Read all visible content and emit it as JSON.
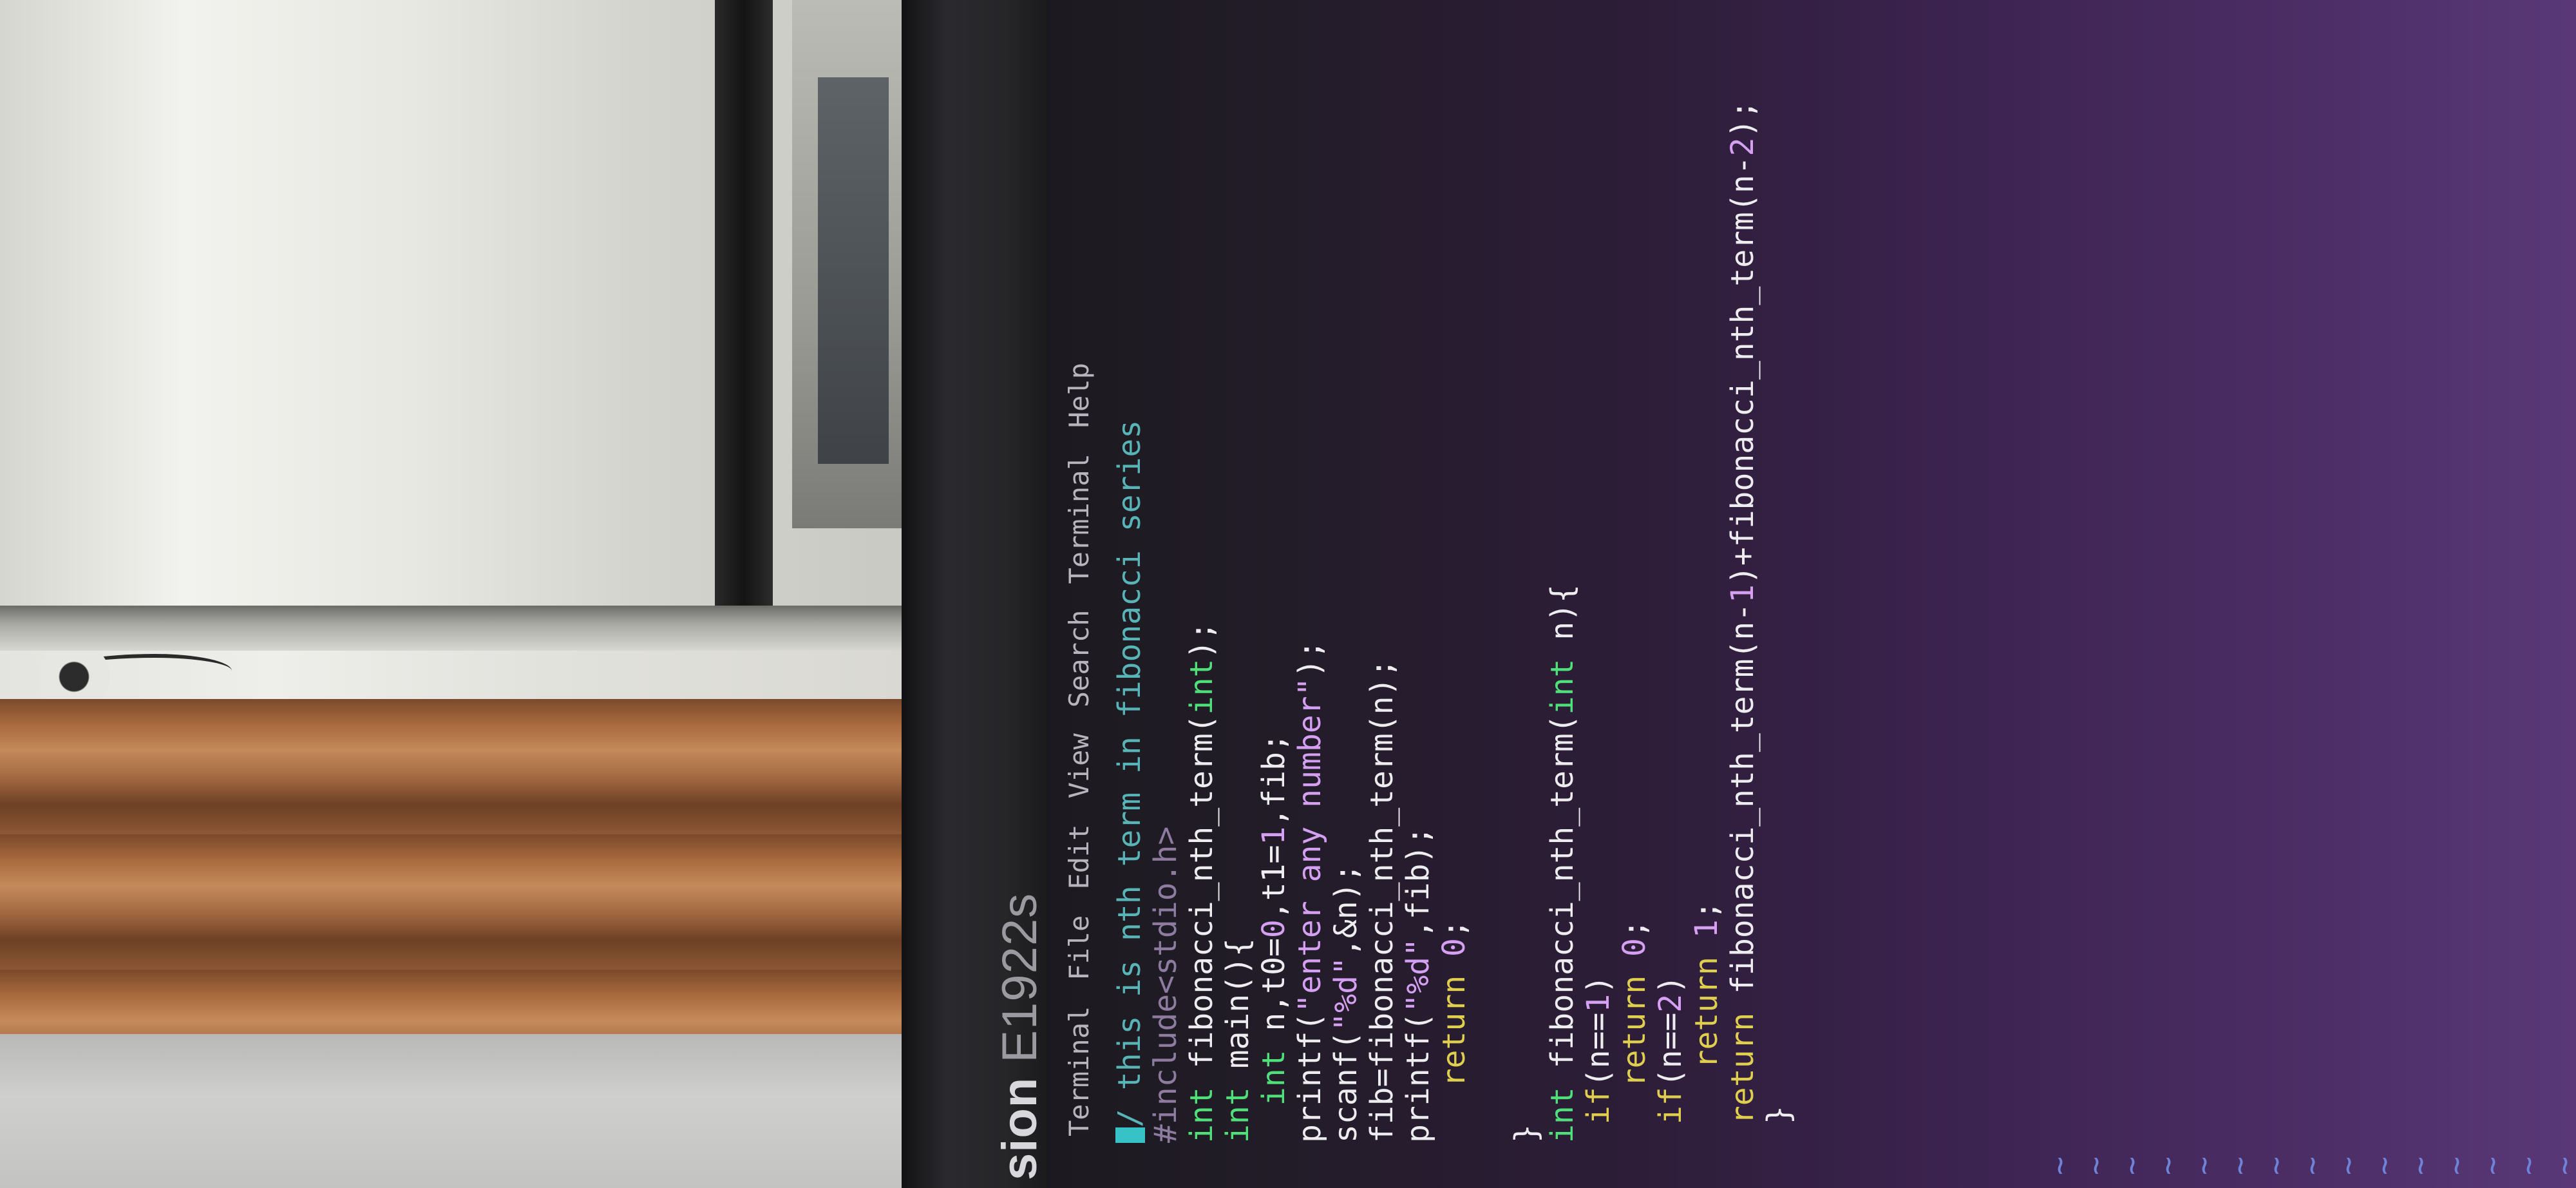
{
  "monitor": {
    "brand_partial": "sion",
    "model": "E1922s"
  },
  "terminal": {
    "menu": [
      "Terminal",
      "File",
      "Edit",
      "View",
      "Search",
      "Terminal",
      "Help"
    ],
    "code_lines": [
      [
        [
          "comment",
          "/ this is nth term in fibonacci series"
        ]
      ],
      [
        [
          "pre",
          "#include<stdio.h>"
        ]
      ],
      [
        [
          "type",
          "int"
        ],
        [
          "plain",
          " fibonacci_nth_term("
        ],
        [
          "type",
          "int"
        ],
        [
          "plain",
          ");"
        ]
      ],
      [
        [
          "type",
          "int"
        ],
        [
          "plain",
          " main(){"
        ]
      ],
      [
        [
          "plain",
          "  "
        ],
        [
          "type",
          "int"
        ],
        [
          "plain",
          " n,t0="
        ],
        [
          "num",
          "0"
        ],
        [
          "plain",
          ",t1="
        ],
        [
          "num",
          "1"
        ],
        [
          "plain",
          ",fib;"
        ]
      ],
      [
        [
          "plain",
          "printf("
        ],
        [
          "str",
          "\"enter any number\""
        ],
        [
          "plain",
          ");"
        ]
      ],
      [
        [
          "plain",
          "scanf("
        ],
        [
          "str",
          "\"%d\""
        ],
        [
          "plain",
          ",&n);"
        ]
      ],
      [
        [
          "plain",
          "fib=fibonacci_nth_term(n);"
        ]
      ],
      [
        [
          "plain",
          "printf("
        ],
        [
          "str",
          "\"%d\""
        ],
        [
          "plain",
          ",fib);"
        ]
      ],
      [
        [
          "plain",
          "   "
        ],
        [
          "kw",
          "return"
        ],
        [
          "plain",
          " "
        ],
        [
          "num",
          "0"
        ],
        [
          "plain",
          ";"
        ]
      ],
      [
        [
          "plain",
          ""
        ]
      ],
      [
        [
          "plain",
          "}"
        ]
      ],
      [
        [
          "type",
          "int"
        ],
        [
          "plain",
          " fibonacci_nth_term("
        ],
        [
          "type",
          "int"
        ],
        [
          "plain",
          " n){"
        ]
      ],
      [
        [
          "plain",
          " "
        ],
        [
          "kw",
          "if"
        ],
        [
          "plain",
          "(n=="
        ],
        [
          "num",
          "1"
        ],
        [
          "plain",
          ")"
        ]
      ],
      [
        [
          "plain",
          "   "
        ],
        [
          "kw",
          "return"
        ],
        [
          "plain",
          " "
        ],
        [
          "num",
          "0"
        ],
        [
          "plain",
          ";"
        ]
      ],
      [
        [
          "plain",
          " "
        ],
        [
          "kw",
          "if"
        ],
        [
          "plain",
          "(n=="
        ],
        [
          "num",
          "2"
        ],
        [
          "plain",
          ")"
        ]
      ],
      [
        [
          "plain",
          "    "
        ],
        [
          "kw",
          "return"
        ],
        [
          "plain",
          " "
        ],
        [
          "num",
          "1"
        ],
        [
          "plain",
          ";"
        ]
      ],
      [
        [
          "plain",
          " "
        ],
        [
          "kw",
          "return"
        ],
        [
          "plain",
          " fibonacci_nth_term(n-"
        ],
        [
          "num",
          "1"
        ],
        [
          "plain",
          ")+fibonacci_nth_term(n-"
        ],
        [
          "num",
          "2"
        ],
        [
          "plain",
          ");"
        ]
      ],
      [
        [
          "plain",
          " }"
        ]
      ]
    ],
    "empty_line_marker": "~",
    "empty_line_count": 15,
    "colors": {
      "comment": "#58b4b6",
      "preprocessor": "#8e7ca0",
      "type": "#4fe07a",
      "keyword": "#e0cf4f",
      "literal": "#d5a0f2",
      "cursor": "#36c2c6",
      "tilde": "#6d84d8"
    }
  }
}
